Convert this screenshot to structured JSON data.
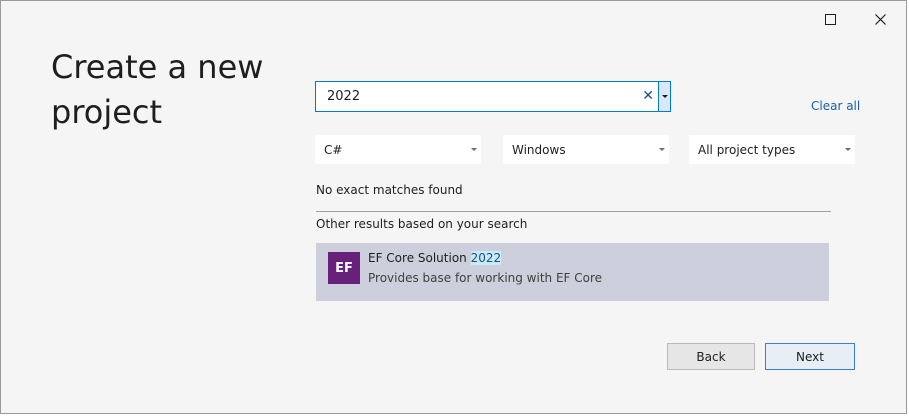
{
  "window": {
    "title": "Create a new project",
    "maximize_icon": "maximize-icon",
    "close_icon": "close-icon"
  },
  "search": {
    "value": "2022",
    "clear_glyph": "✕",
    "clear_all_label": "Clear all"
  },
  "filters": {
    "language": "C#",
    "platform": "Windows",
    "project_type": "All project types"
  },
  "messages": {
    "no_matches": "No exact matches found",
    "other_results": "Other results based on your search"
  },
  "results": [
    {
      "icon_text": "EF",
      "icon_color": "#68217a",
      "title_prefix": "EF Core Solution ",
      "title_highlight": "2022",
      "description": "Provides base for working with EF Core"
    }
  ],
  "buttons": {
    "back": "Back",
    "next": "Next"
  },
  "colors": {
    "accent": "#0078d4",
    "link": "#1a5fb4",
    "selected_row": "#cdd0dc"
  }
}
